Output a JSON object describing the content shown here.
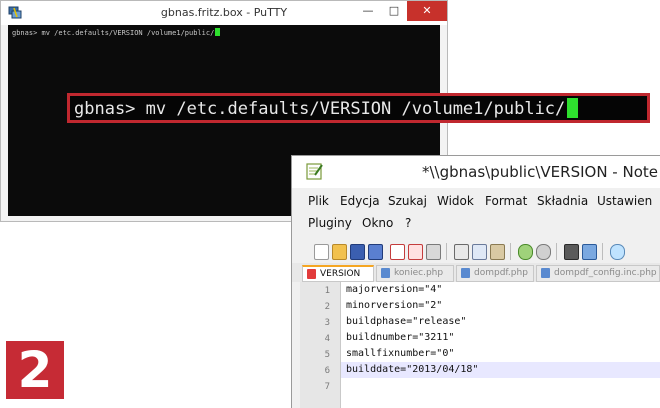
{
  "putty": {
    "title": "gbnas.fritz.box - PuTTY",
    "window_buttons": {
      "minimize": "—",
      "maximize": "□",
      "close": "✕"
    },
    "terminal_command": "gbnas> mv /etc.defaults/VERSION /volume1/public/"
  },
  "callout": {
    "command": "gbnas> mv /etc.defaults/VERSION /volume1/public/"
  },
  "notepad": {
    "title": "*\\\\gbnas\\public\\VERSION - Note",
    "menu": [
      "Plik",
      "Edycja",
      "Szukaj",
      "Widok",
      "Format",
      "Składnia",
      "Ustawien",
      "Pluginy",
      "Okno",
      "?"
    ],
    "tabs": [
      {
        "label": "VERSION",
        "active": true
      },
      {
        "label": "koniec.php",
        "active": false
      },
      {
        "label": "dompdf.php",
        "active": false
      },
      {
        "label": "dompdf_config.inc.php",
        "active": false
      }
    ],
    "lines": [
      {
        "number": "1",
        "text": "majorversion=\"4\""
      },
      {
        "number": "2",
        "text": "minorversion=\"2\""
      },
      {
        "number": "3",
        "text": "buildphase=\"release\""
      },
      {
        "number": "4",
        "text": "buildnumber=\"3211\""
      },
      {
        "number": "5",
        "text": "smallfixnumber=\"0\""
      },
      {
        "number": "6",
        "text": "builddate=\"2013/04/18\""
      },
      {
        "number": "7",
        "text": ""
      }
    ],
    "toolbar_icons": [
      "new-file-icon",
      "open-file-icon",
      "save-icon",
      "save-all-icon",
      "close-icon",
      "close-all-icon",
      "print-icon",
      "cut-icon",
      "copy-icon",
      "paste-icon",
      "undo-icon",
      "redo-icon",
      "find-icon",
      "replace-icon",
      "zoom-icon"
    ]
  },
  "step_badge": "2",
  "colors": {
    "highlight_red": "#c0282f",
    "cursor_green": "#2ee02e",
    "badge_red": "#c62b35",
    "tab_accent": "#f5a623"
  }
}
